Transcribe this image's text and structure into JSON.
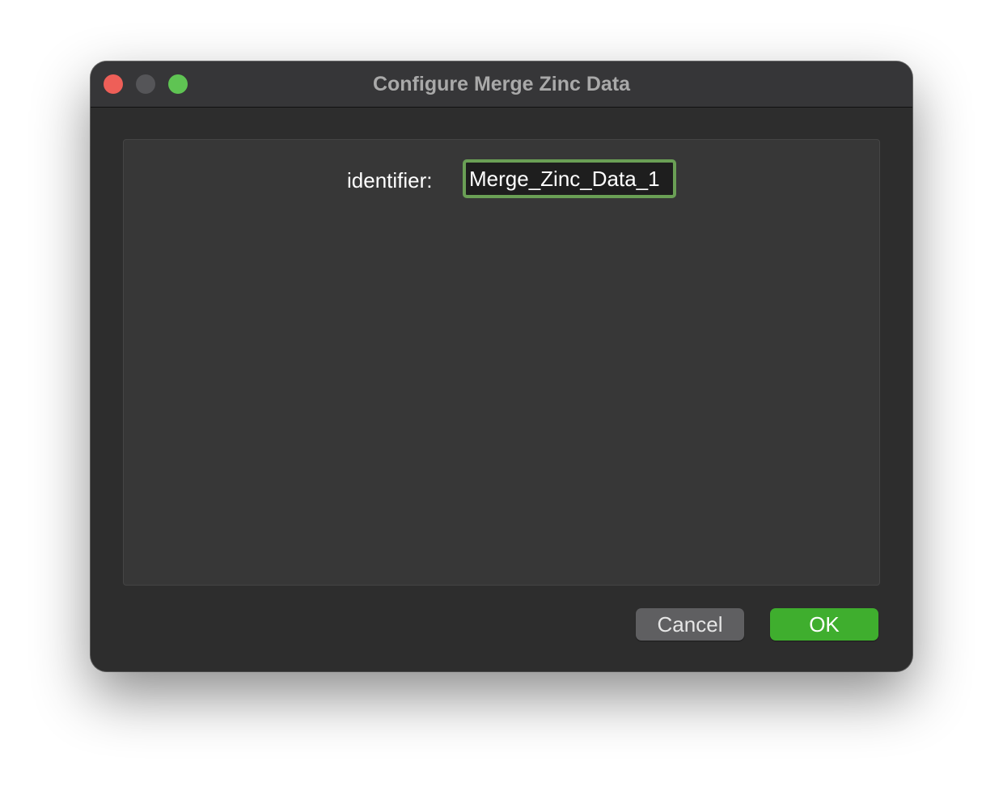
{
  "window": {
    "title": "Configure Merge Zinc Data",
    "controls": {
      "close": "close",
      "minimize": "minimize",
      "zoom": "zoom"
    }
  },
  "form": {
    "identifier_label": "identifier:",
    "identifier_value": "Merge_Zinc_Data_1"
  },
  "buttons": {
    "cancel_label": "Cancel",
    "ok_label": "OK"
  },
  "colors": {
    "accent_green": "#3fae2e",
    "focus_ring": "#6a9f55",
    "close_red": "#ee5f58",
    "zoom_green": "#5fc453"
  }
}
